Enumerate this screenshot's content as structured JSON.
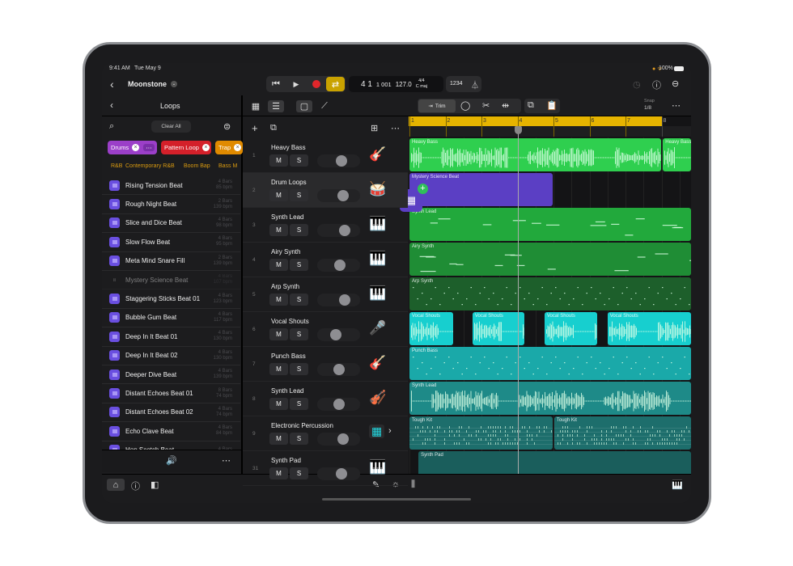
{
  "status": {
    "time": "9:41 AM",
    "date": "Tue May 9",
    "battery": "100%"
  },
  "header": {
    "project": "Moonstone",
    "position_bar": "4 1",
    "position_tick": "1 001",
    "tempo": "127.0",
    "signature": "4/4",
    "key": "C maj",
    "count_in": "1234"
  },
  "colors": {
    "cycle": "#c9a200",
    "record": "#e0262b",
    "ruler": "#e6b400"
  },
  "toolbar": {
    "trim": "Trim",
    "snap_label": "Snap",
    "snap_value": "1/8"
  },
  "loops": {
    "title": "Loops",
    "clear_all": "Clear All",
    "filters": [
      {
        "label": "Drums",
        "color": "#9b3fc8"
      },
      {
        "label": "Pattern Loop",
        "color": "#d4202a"
      },
      {
        "label": "Trap",
        "color": "#e08a00"
      }
    ],
    "genres": [
      "R&B",
      "Contemporary R&B",
      "Boom Bap",
      "Bass M"
    ],
    "items": [
      {
        "name": "Rising Tension Beat",
        "bars": "4 Bars",
        "bpm": "85 bpm"
      },
      {
        "name": "Rough Night Beat",
        "bars": "2 Bars",
        "bpm": "139 bpm"
      },
      {
        "name": "Slice and Dice Beat",
        "bars": "4 Bars",
        "bpm": "98 bpm"
      },
      {
        "name": "Slow Flow Beat",
        "bars": "4 Bars",
        "bpm": "95 bpm"
      },
      {
        "name": "Meta Mind Snare Fill",
        "bars": "2 Bars",
        "bpm": "139 bpm"
      },
      {
        "name": "Mystery Science Beat",
        "bars": "4 Bars",
        "bpm": "107 bpm",
        "dragging": true
      },
      {
        "name": "Staggering Sticks Beat 01",
        "bars": "4 Bars",
        "bpm": "123 bpm"
      },
      {
        "name": "Bubble Gum Beat",
        "bars": "4 Bars",
        "bpm": "117 bpm"
      },
      {
        "name": "Deep In It Beat 01",
        "bars": "4 Bars",
        "bpm": "130 bpm"
      },
      {
        "name": "Deep In It Beat 02",
        "bars": "4 Bars",
        "bpm": "130 bpm"
      },
      {
        "name": "Deeper Dive Beat",
        "bars": "4 Bars",
        "bpm": "139 bpm"
      },
      {
        "name": "Distant Echoes Beat 01",
        "bars": "8 Bars",
        "bpm": "74 bpm"
      },
      {
        "name": "Distant Echoes Beat 02",
        "bars": "4 Bars",
        "bpm": "74 bpm"
      },
      {
        "name": "Echo Clave Beat",
        "bars": "4 Bars",
        "bpm": "84 bpm"
      },
      {
        "name": "Hop Scotch Beat",
        "bars": "4 Bars",
        "bpm": ""
      }
    ]
  },
  "ruler": [
    "1",
    "2",
    "3",
    "4",
    "5",
    "6",
    "7",
    "8"
  ],
  "playhead_bar": 4,
  "tracks": [
    {
      "num": "1",
      "name": "Heavy Bass",
      "icon": "🎸",
      "volume": 0.6,
      "color": "#2fcf4f",
      "kind": "audio",
      "regions": [
        {
          "label": "Heavy Bass",
          "start": 1,
          "end": 8
        },
        {
          "label": "Heavy Bass",
          "start": 8.04,
          "end": 9
        }
      ]
    },
    {
      "num": "2",
      "name": "Drum Loops",
      "icon": "🥁",
      "volume": 0.65,
      "color": "#5b3fc4",
      "kind": "drop",
      "regions": [
        {
          "label": "Mystery Science Beat",
          "start": 1,
          "end": 5
        }
      ]
    },
    {
      "num": "3",
      "name": "Synth Lead",
      "icon": "🎹",
      "volume": 0.7,
      "color": "#22a93c",
      "kind": "midi",
      "regions": [
        {
          "label": "Synth Lead",
          "start": 1,
          "end": 9
        }
      ]
    },
    {
      "num": "4",
      "name": "Airy Synth",
      "icon": "🎹",
      "volume": 0.55,
      "color": "#1f8d35",
      "kind": "midi",
      "regions": [
        {
          "label": "Airy Synth",
          "start": 1,
          "end": 9
        }
      ]
    },
    {
      "num": "5",
      "name": "Arp Synth",
      "icon": "🎹",
      "volume": 0.7,
      "color": "#1d5f2b",
      "kind": "dots",
      "regions": [
        {
          "label": "Arp Synth",
          "start": 1,
          "end": 9
        }
      ]
    },
    {
      "num": "6",
      "name": "Vocal Shouts",
      "icon": "🎤",
      "volume": 0.4,
      "color": "#17cfcf",
      "kind": "audio",
      "regions": [
        {
          "label": "Vocal Shouts",
          "start": 1,
          "end": 2.24
        },
        {
          "label": "Vocal Shouts",
          "start": 2.75,
          "end": 4.22
        },
        {
          "label": "Vocal Shouts",
          "start": 4.75,
          "end": 6.23
        },
        {
          "label": "Vocal Shouts",
          "start": 6.5,
          "end": 9
        }
      ]
    },
    {
      "num": "7",
      "name": "Punch Bass",
      "icon": "🎸",
      "volume": 0.5,
      "color": "#1aa9a9",
      "kind": "dots",
      "regions": [
        {
          "label": "Punch Bass",
          "start": 1,
          "end": 9
        }
      ]
    },
    {
      "num": "8",
      "name": "Synth Lead",
      "icon": "🎻",
      "volume": 0.5,
      "color": "#1e8a88",
      "kind": "audio",
      "regions": [
        {
          "label": "Synth Lead",
          "start": 1,
          "end": 9
        }
      ]
    },
    {
      "num": "9",
      "name": "Electronic Percussion",
      "icon": "▦",
      "volume": 0.65,
      "color": "#1d6e6c",
      "kind": "drums",
      "regions": [
        {
          "label": "Tough Kit",
          "start": 1,
          "end": 5
        },
        {
          "label": "Tough Kit",
          "start": 5.02,
          "end": 9
        }
      ]
    },
    {
      "num": "31",
      "name": "Synth Pad",
      "icon": "🎹",
      "volume": 0.6,
      "color": "#1a5e5c",
      "kind": "pad",
      "regions": [
        {
          "label": "Synth Pad",
          "start": 1.25,
          "end": 9
        }
      ]
    }
  ]
}
